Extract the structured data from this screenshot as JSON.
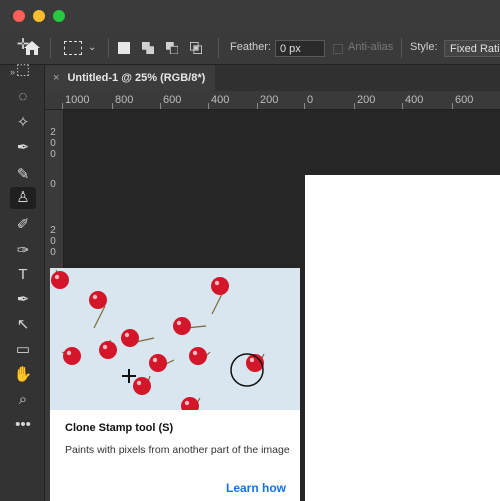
{
  "window": {
    "traffic_lights": [
      {
        "name": "close",
        "color": "#fe5f57"
      },
      {
        "name": "minimize",
        "color": "#febc2e"
      },
      {
        "name": "maximize",
        "color": "#28c840"
      }
    ]
  },
  "options_bar": {
    "feather_label": "Feather:",
    "feather_value": "0 px",
    "antialias_label": "Anti-alias",
    "style_label": "Style:",
    "style_value": "Fixed Ratio"
  },
  "toolbar": {
    "collapse_glyph": "»",
    "tools": [
      {
        "name": "move-tool",
        "icon": "move-icon",
        "glyph": "✛"
      },
      {
        "name": "marquee-tool",
        "icon": "marquee-icon",
        "glyph": "⬚"
      },
      {
        "name": "lasso-tool",
        "icon": "lasso-icon",
        "glyph": "◌"
      },
      {
        "name": "magic-wand-tool",
        "icon": "magic-wand-icon",
        "glyph": "✧"
      },
      {
        "name": "eyedropper-tool",
        "icon": "eyedropper-icon",
        "glyph": "✒"
      },
      {
        "name": "brush-tool",
        "icon": "brush-icon",
        "glyph": "✎"
      },
      {
        "name": "clone-stamp-tool",
        "icon": "clone-stamp-icon",
        "glyph": "♙"
      },
      {
        "name": "history-brush-tool",
        "icon": "history-brush-icon",
        "glyph": "✐"
      },
      {
        "name": "eraser-tool",
        "icon": "eraser-icon",
        "glyph": "✑"
      },
      {
        "name": "type-tool",
        "icon": "type-icon",
        "glyph": "T"
      },
      {
        "name": "pen-tool",
        "icon": "pen-icon",
        "glyph": "✒"
      },
      {
        "name": "path-selection-tool",
        "icon": "arrow-icon",
        "glyph": "↖"
      },
      {
        "name": "rectangle-tool",
        "icon": "rectangle-icon",
        "glyph": "▭"
      },
      {
        "name": "hand-tool",
        "icon": "hand-icon",
        "glyph": "✋"
      },
      {
        "name": "zoom-tool",
        "icon": "zoom-icon",
        "glyph": "⌕"
      },
      {
        "name": "more-tools",
        "icon": "more-icon",
        "glyph": "•••"
      }
    ]
  },
  "document_tab": {
    "close_glyph": "×",
    "title": "Untitled-1 @ 25% (RGB/8*)"
  },
  "ruler": {
    "h_labels": [
      "1000",
      "800",
      "600",
      "400",
      "200",
      "0",
      "200",
      "400",
      "600"
    ],
    "v_labels": [
      "2",
      "0",
      "0",
      "0",
      "2",
      "0",
      "0"
    ]
  },
  "tooltip": {
    "title": "Clone Stamp tool (S)",
    "description": "Paints with pixels from another part of the image",
    "link": "Learn how"
  },
  "colors": {
    "accent_link": "#1473e6",
    "cherry": "#d3162a"
  }
}
